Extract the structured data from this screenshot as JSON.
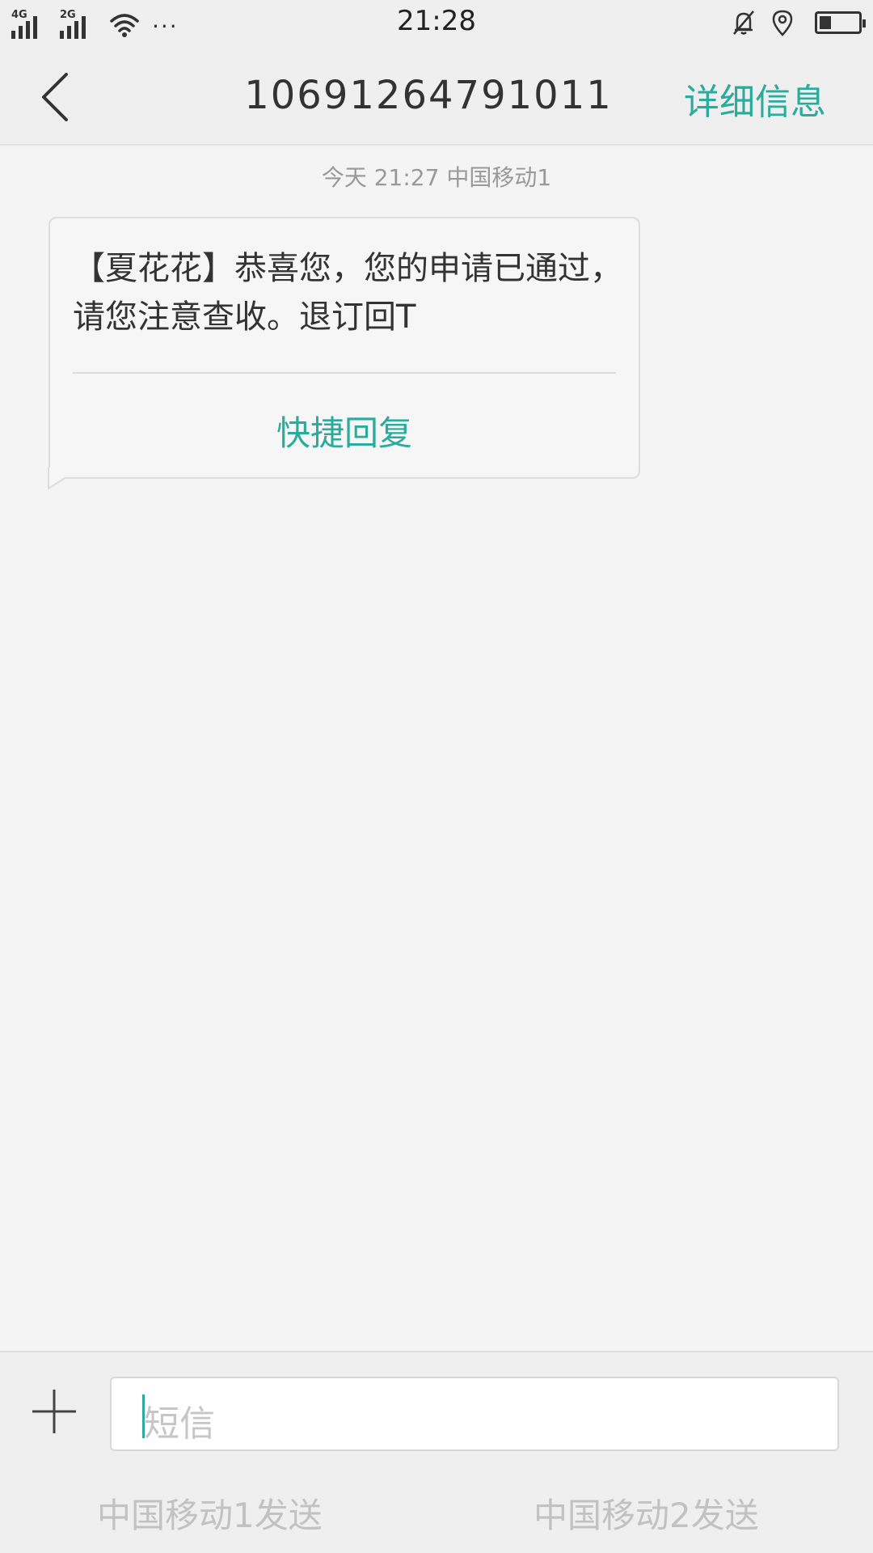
{
  "status_bar": {
    "network_sim1": "4G",
    "network_sim2": "2G",
    "more": "···",
    "time": "21:28",
    "icons": [
      "signal-icon",
      "wifi-icon",
      "bell-muted-icon",
      "location-icon",
      "battery-icon"
    ],
    "battery_level": 0.3
  },
  "header": {
    "back_icon": "chevron-left-icon",
    "title": "10691264791011",
    "details_label": "详细信息"
  },
  "conversation": {
    "timestamp": "今天  21:27  中国移动1",
    "message": {
      "text": "【夏花花】恭喜您，您的申请已通过，请您注意查收。退订回T",
      "quick_reply_label": "快捷回复"
    }
  },
  "composer": {
    "add_icon": "plus-icon",
    "placeholder": "短信",
    "send_sim1_label": "中国移动1发送",
    "send_sim2_label": "中国移动2发送"
  },
  "colors": {
    "accent": "#2aab9b",
    "background": "#f4f4f4",
    "bar": "#efefef"
  }
}
